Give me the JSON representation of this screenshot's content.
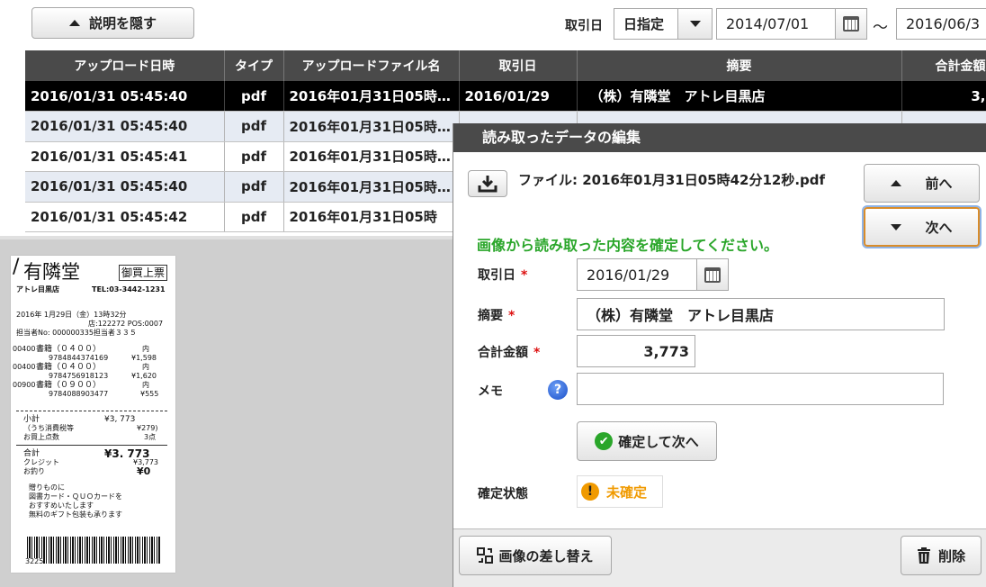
{
  "toolbar": {
    "hide_desc_label": "説明を隠す",
    "trade_date_label": "取引日",
    "date_mode": "日指定",
    "date_from": "2014/07/01",
    "date_sep": "〜",
    "date_to": "2016/06/3"
  },
  "table": {
    "headers": [
      "アップロード日時",
      "タイプ",
      "アップロードファイル名",
      "取引日",
      "摘要",
      "合計金額"
    ],
    "rows": [
      [
        "2016/01/31 05:45:40",
        "pdf",
        "2016年01月31日05時…",
        "2016/01/29",
        "（株）有隣堂　アトレ目黒店",
        "3,"
      ],
      [
        "2016/01/31 05:45:40",
        "pdf",
        "2016年01月31日05時…",
        "",
        "",
        ""
      ],
      [
        "2016/01/31 05:45:41",
        "pdf",
        "2016年01月31日05時…",
        "",
        "",
        ""
      ],
      [
        "2016/01/31 05:45:40",
        "pdf",
        "2016年01月31日05時…",
        "",
        "",
        ""
      ],
      [
        "2016/01/31 05:45:42",
        "pdf",
        "2016年01月31日05時",
        "",
        "",
        ""
      ]
    ]
  },
  "receipt": {
    "shop": "有隣堂",
    "stamp": "御買上票",
    "branch": "アトレ目黒店",
    "tel": "TEL:03-3442-1231",
    "line1": "2016年 1月29日（金）13時32分",
    "line2": "店:122272 POS:0007",
    "line3": "担当者No: 000000335担当者３３５",
    "item1_code": "00400",
    "item1_name": "書籍（０４００）",
    "item1_isbn": "9784844374169",
    "item1_tax": "内",
    "item1_price": "¥1,598",
    "item2_code": "00400",
    "item2_name": "書籍（０４００）",
    "item2_isbn": "9784756918123",
    "item2_tax": "内",
    "item2_price": "¥1,620",
    "item3_code": "00900",
    "item3_name": "書籍（０９００）",
    "item3_isbn": "9784088903477",
    "item3_tax": "内",
    "item3_price": "¥555",
    "subtotal_label": "小計",
    "subtotal": "¥3, 773",
    "tax_label": "（うち消費税等",
    "tax": "¥279)",
    "count_label": "お買上点数",
    "count": "3点",
    "total_label": "合計",
    "total": "¥3. 773",
    "credit_label": "クレジット",
    "credit": "¥3,773",
    "change_label": "お釣り",
    "change": "¥0",
    "msg1": "贈りものに",
    "msg2": "図書カード・ＱＵＯカードを",
    "msg3": "おすすめいたします",
    "msg4": "無料のギフト包装も承ります",
    "footer": "3225"
  },
  "dialog": {
    "title": "読み取ったデータの編集",
    "file_label": "ファイル: 2016年01月31日05時42分12秒.pdf",
    "prev_label": "前へ",
    "next_label": "次へ",
    "instruction": "画像から読み取った内容を確定してください。",
    "date_label": "取引日",
    "date_value": "2016/01/29",
    "summary_label": "摘要",
    "summary_value": "（株）有隣堂　アトレ目黒店",
    "amount_label": "合計金額",
    "amount_value": "3,773",
    "memo_label": "メモ",
    "memo_value": "",
    "confirm_label": "確定して次へ",
    "status_label": "確定状態",
    "status_value": "未確定",
    "replace_label": "画像の差し替え",
    "delete_label": "削除",
    "required_mark": "*"
  },
  "colors": {
    "header_bg": "#4a4a4a",
    "selected_row": "#000000",
    "instruction_green": "#2aa62a",
    "status_orange": "#f09a00",
    "focus_border": "#d98c2a"
  }
}
